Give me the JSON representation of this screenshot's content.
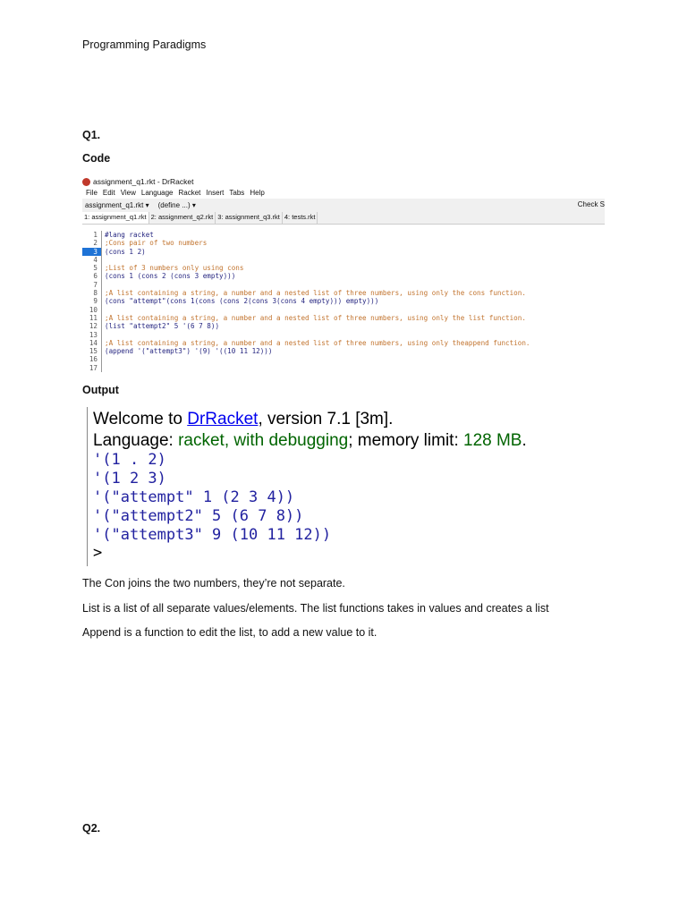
{
  "header": "Programming Paradigms",
  "q1": "Q1.",
  "code_label": "Code",
  "drracket": {
    "title": "assignment_q1.rkt - DrRacket",
    "menu": [
      "File",
      "Edit",
      "View",
      "Language",
      "Racket",
      "Insert",
      "Tabs",
      "Help"
    ],
    "file_dropdown": "assignment_q1.rkt ▾",
    "define_dropdown": "(define ...) ▾",
    "check_syntax": "Check S",
    "tabs": [
      "1: assignment_q1.rkt",
      "2: assignment_q2.rkt",
      "3: assignment_q3.rkt",
      "4: tests.rkt"
    ],
    "lines": [
      {
        "n": "1",
        "t": "#lang racket",
        "c": "cd"
      },
      {
        "n": "2",
        "t": ";Cons pair of two numbers",
        "c": "cm"
      },
      {
        "n": "3",
        "t": "(cons 1 2)",
        "c": "cd"
      },
      {
        "n": "4",
        "t": "",
        "c": "cd"
      },
      {
        "n": "5",
        "t": ";List of 3 numbers only using cons",
        "c": "cm"
      },
      {
        "n": "6",
        "t": "(cons 1 (cons 2 (cons 3 empty)))",
        "c": "cd"
      },
      {
        "n": "7",
        "t": "",
        "c": "cd"
      },
      {
        "n": "8",
        "t": ";A list containing a string, a number and a nested list of three numbers, using only the cons function.",
        "c": "cm"
      },
      {
        "n": "9",
        "t": "(cons \"attempt\"(cons 1(cons (cons 2(cons 3(cons 4 empty))) empty)))",
        "c": "cd"
      },
      {
        "n": "10",
        "t": "",
        "c": "cd"
      },
      {
        "n": "11",
        "t": ";A list containing a string, a number and a nested list of three numbers, using only the list function.",
        "c": "cm"
      },
      {
        "n": "12",
        "t": "(list \"attempt2\" 5 '(6 7 8))",
        "c": "cd"
      },
      {
        "n": "13",
        "t": "",
        "c": "cd"
      },
      {
        "n": "14",
        "t": ";A list containing a string, a number and a nested list of three numbers, using only theappend function.",
        "c": "cm"
      },
      {
        "n": "15",
        "t": "(append '(\"attempt3\") '(9) '((10 11 12)))",
        "c": "cd"
      },
      {
        "n": "16",
        "t": "",
        "c": "cd"
      },
      {
        "n": "17",
        "t": "",
        "c": "cd"
      }
    ]
  },
  "output_label": "Output",
  "repl": {
    "welcome": "Welcome to ",
    "link": "DrRacket",
    "version": ", version 7.1 [3m].",
    "lang_label": "Language: ",
    "lang": "racket, with debugging",
    "mem_label": "; memory limit: ",
    "mem": "128 MB",
    "end": ".",
    "results": [
      "'(1 . 2)",
      "'(1 2 3)",
      "'(\"attempt\" 1 (2 3 4))",
      "'(\"attempt2\" 5 (6 7 8))",
      "'(\"attempt3\" 9 (10 11 12))"
    ],
    "prompt": ">"
  },
  "paragraphs": [
    "The Con joins the two numbers, they’re not separate.",
    "List is a list of all separate values/elements. The list functions takes in values and creates a list",
    "Append is a function to edit the list, to add a new value to it."
  ],
  "q2": "Q2."
}
